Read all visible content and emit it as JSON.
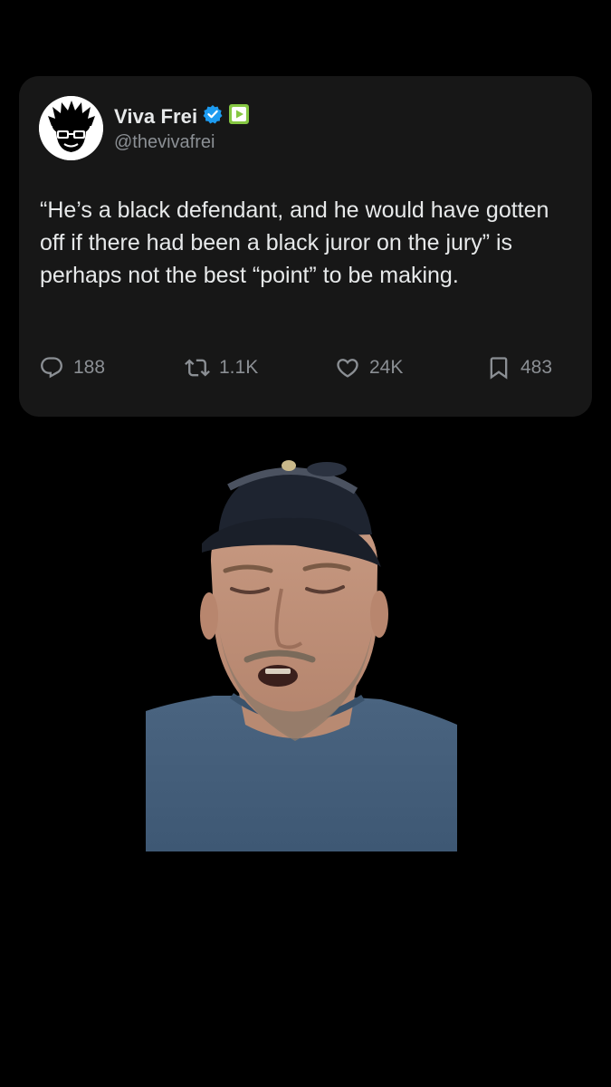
{
  "tweet": {
    "display_name": "Viva Frei",
    "handle": "@thevivafrei",
    "text": "“He’s a black defendant, and he would have gotten off if there had been a black juror on the jury” is perhaps not the best “point” to be making.",
    "verified_color": "#1d9bf0",
    "rumble_badge_color": "#85c742"
  },
  "actions": {
    "replies": "188",
    "reposts": "1.1K",
    "likes": "24K",
    "bookmarks": "483",
    "icons": [
      "reply-icon",
      "repost-icon",
      "like-icon",
      "bookmark-icon"
    ]
  },
  "video": {
    "subject": "man in navy cap and blue t-shirt speaking to camera"
  },
  "colors": {
    "background": "#000000",
    "card": "#171717",
    "text_primary": "#e7e9ea",
    "text_secondary": "#8b8f94"
  }
}
